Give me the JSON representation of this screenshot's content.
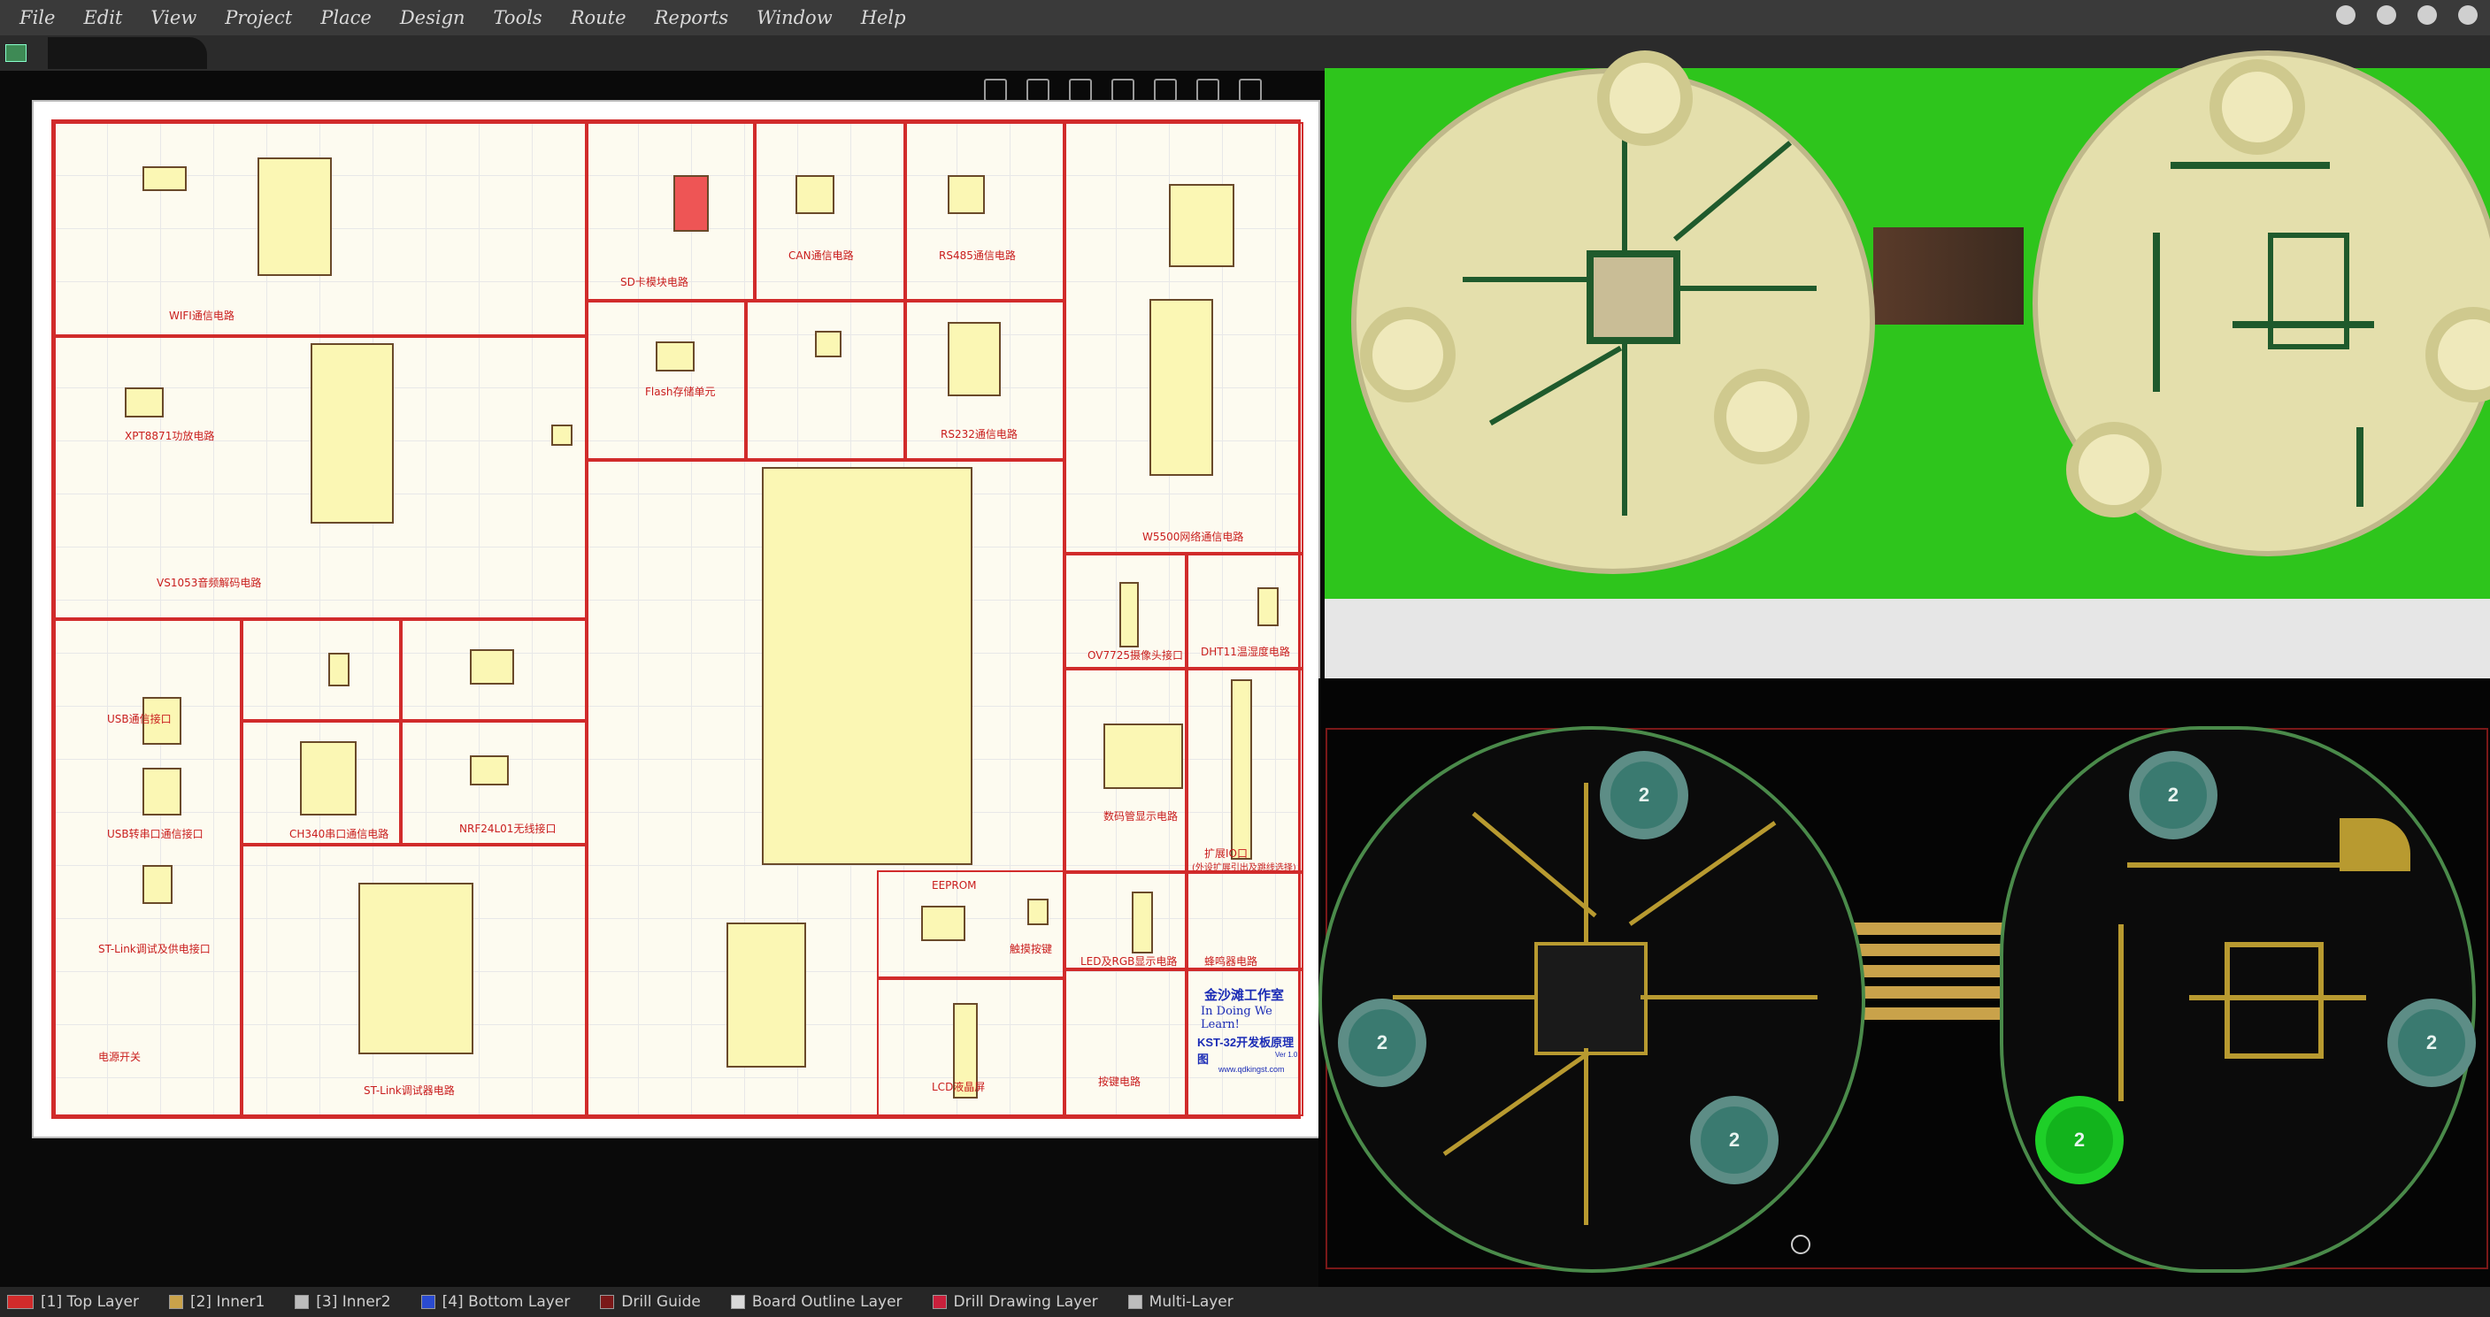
{
  "menu": {
    "items": [
      "File",
      "Edit",
      "View",
      "Project",
      "Place",
      "Design",
      "Tools",
      "Route",
      "Reports",
      "Window",
      "Help"
    ]
  },
  "right_icons": [
    "gear-icon",
    "bell-icon",
    "user-icon",
    "settings-icon"
  ],
  "schematic": {
    "labels": {
      "wifi": "WIFI通信电路",
      "sd": "SD卡模块电路",
      "can": "CAN通信电路",
      "rs485": "RS485通信电路",
      "flash": "Flash存储单元",
      "rs232": "RS232通信电路",
      "xpt": "XPT8871功放电路",
      "vs1053": "VS1053音频解码电路",
      "w5500": "W5500网络通信电路",
      "ov7725": "OV7725摄像头接口",
      "dht11": "DHT11温湿度电路",
      "usb": "USB通信接口",
      "usbserial": "USB转串口通信接口",
      "ch340": "CH340串口通信电路",
      "nrf": "NRF24L01无线接口",
      "digit": "数码管显示电路",
      "expand": "扩展IO口",
      "expand_sub": "(外设扩展引出及跳线选择)",
      "stlink_power": "ST-Link调试及供电接口",
      "eeprom": "EEPROM",
      "touch": "触摸按键",
      "led_rgb": "LED及RGB显示电路",
      "buzzer": "蜂鸣器电路",
      "power_switch": "电源开关",
      "stlink": "ST-Link调试器电路",
      "lcd": "LCD液晶屏",
      "keys": "按键电路"
    },
    "title_block": {
      "studio": "金沙滩工作室",
      "slogan": "In Doing We Learn!",
      "board": "KST-32开发板原理图",
      "url": "www.qdkingst.com",
      "version": "Ver 1.0"
    }
  },
  "status_layers": [
    {
      "name": "[1] Top Layer",
      "color": "#d12b2b"
    },
    {
      "name": "[2] Inner1",
      "color": "#c9a24a"
    },
    {
      "name": "[3] Inner2",
      "color": "#bdbdbd"
    },
    {
      "name": "[4] Bottom Layer",
      "color": "#2a4bd0"
    },
    {
      "name": "Drill Guide",
      "color": "#7a1818"
    },
    {
      "name": "Board Outline Layer",
      "color": "#d9d9d9"
    },
    {
      "name": "Drill Drawing Layer",
      "color": "#c9203c"
    },
    {
      "name": "Multi-Layer",
      "color": "#bdbdbd"
    }
  ]
}
